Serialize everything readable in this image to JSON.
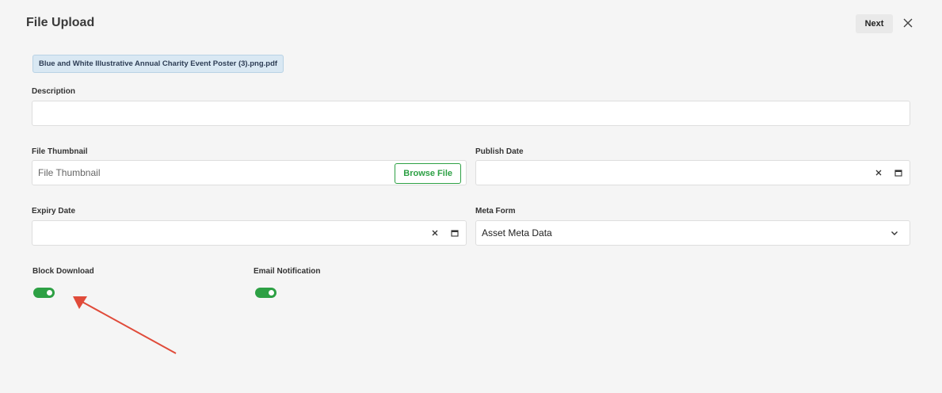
{
  "header": {
    "title": "File Upload",
    "next_label": "Next"
  },
  "file_chip": "Blue and White Illustrative Annual Charity Event Poster (3).png.pdf",
  "description": {
    "label": "Description",
    "value": ""
  },
  "thumbnail": {
    "label": "File Thumbnail",
    "placeholder": "File Thumbnail",
    "browse_label": "Browse File"
  },
  "publish_date": {
    "label": "Publish Date",
    "value": ""
  },
  "expiry_date": {
    "label": "Expiry Date",
    "value": ""
  },
  "meta_form": {
    "label": "Meta Form",
    "selected": "Asset Meta Data"
  },
  "toggles": {
    "block_download": {
      "label": "Block Download",
      "on": true
    },
    "email_notification": {
      "label": "Email Notification",
      "on": true
    }
  },
  "colors": {
    "accent_green": "#2da044",
    "annotation_arrow": "#e04b3a",
    "chip_bg": "#d9e8f3"
  }
}
